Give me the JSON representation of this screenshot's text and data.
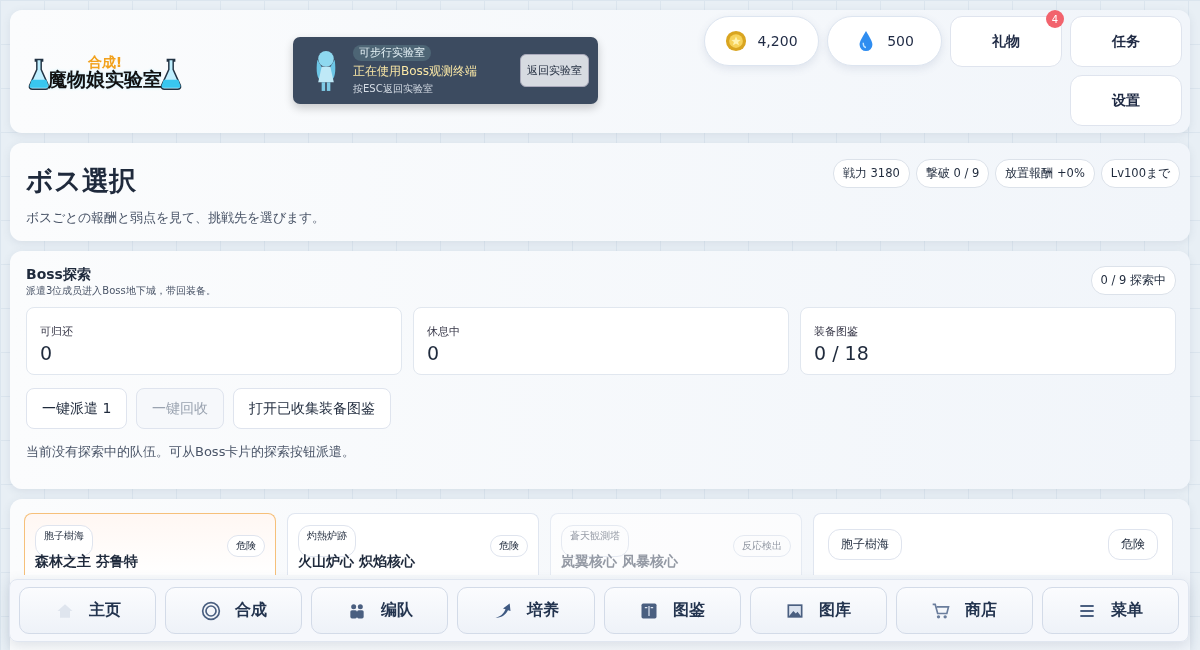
{
  "logo": {
    "top": "合成!",
    "main": "魔物娘实验室"
  },
  "banner": {
    "tag": "可步行实验室",
    "title": "正在使用Boss观测终端",
    "hint": "按ESC返回实验室",
    "button": "返回实验室"
  },
  "currencies": [
    {
      "kind": "coin",
      "amount": "4,200"
    },
    {
      "kind": "gem",
      "amount": "500"
    }
  ],
  "top_buttons": [
    {
      "label": "礼物",
      "badge": "4"
    },
    {
      "label": "任务"
    },
    {
      "label": "设置"
    }
  ],
  "boss_select": {
    "title": "ボス選択",
    "description": "ボスごとの報酬と弱点を見て、挑戦先を選びます。",
    "chips": [
      "戦力 3180",
      "撃破 0 / 9",
      "放置報酬 +0%",
      "Lv100まで"
    ]
  },
  "exploration": {
    "title": "Boss探索",
    "subtitle": "派遣3位成员进入Boss地下城，带回装备。",
    "status": "0 / 9 探索中",
    "stats": [
      {
        "label": "可归还",
        "value": "0"
      },
      {
        "label": "休息中",
        "value": "0"
      },
      {
        "label": "装备图鉴",
        "value": "0 / 18"
      }
    ],
    "actions": [
      {
        "label": "一键派遣 1",
        "disabled": false
      },
      {
        "label": "一键回收",
        "disabled": true
      },
      {
        "label": "打开已收集装备图鉴",
        "disabled": false
      }
    ],
    "note": "当前没有探索中的队伍。可从Boss卡片的探索按钮派遣。"
  },
  "boss_cards": [
    {
      "area": "胞子樹海",
      "title": "森林之主 芬鲁特",
      "risk": "危険",
      "selected": true,
      "dimmed": false
    },
    {
      "area": "灼熱炉跡",
      "title": "火山炉心 炽焰核心",
      "risk": "危険",
      "selected": false,
      "dimmed": false
    },
    {
      "area": "蒼天観測塔",
      "title": "岚翼核心 风暴核心",
      "risk": "反応検出",
      "selected": false,
      "dimmed": true
    },
    {
      "area": "胞子樹海",
      "risk": "危険",
      "selected": false,
      "dimmed": false
    }
  ],
  "nav": [
    {
      "label": "主页"
    },
    {
      "label": "合成"
    },
    {
      "label": "编队"
    },
    {
      "label": "培养"
    },
    {
      "label": "图鉴"
    },
    {
      "label": "图库"
    },
    {
      "label": "商店"
    },
    {
      "label": "菜单"
    }
  ]
}
